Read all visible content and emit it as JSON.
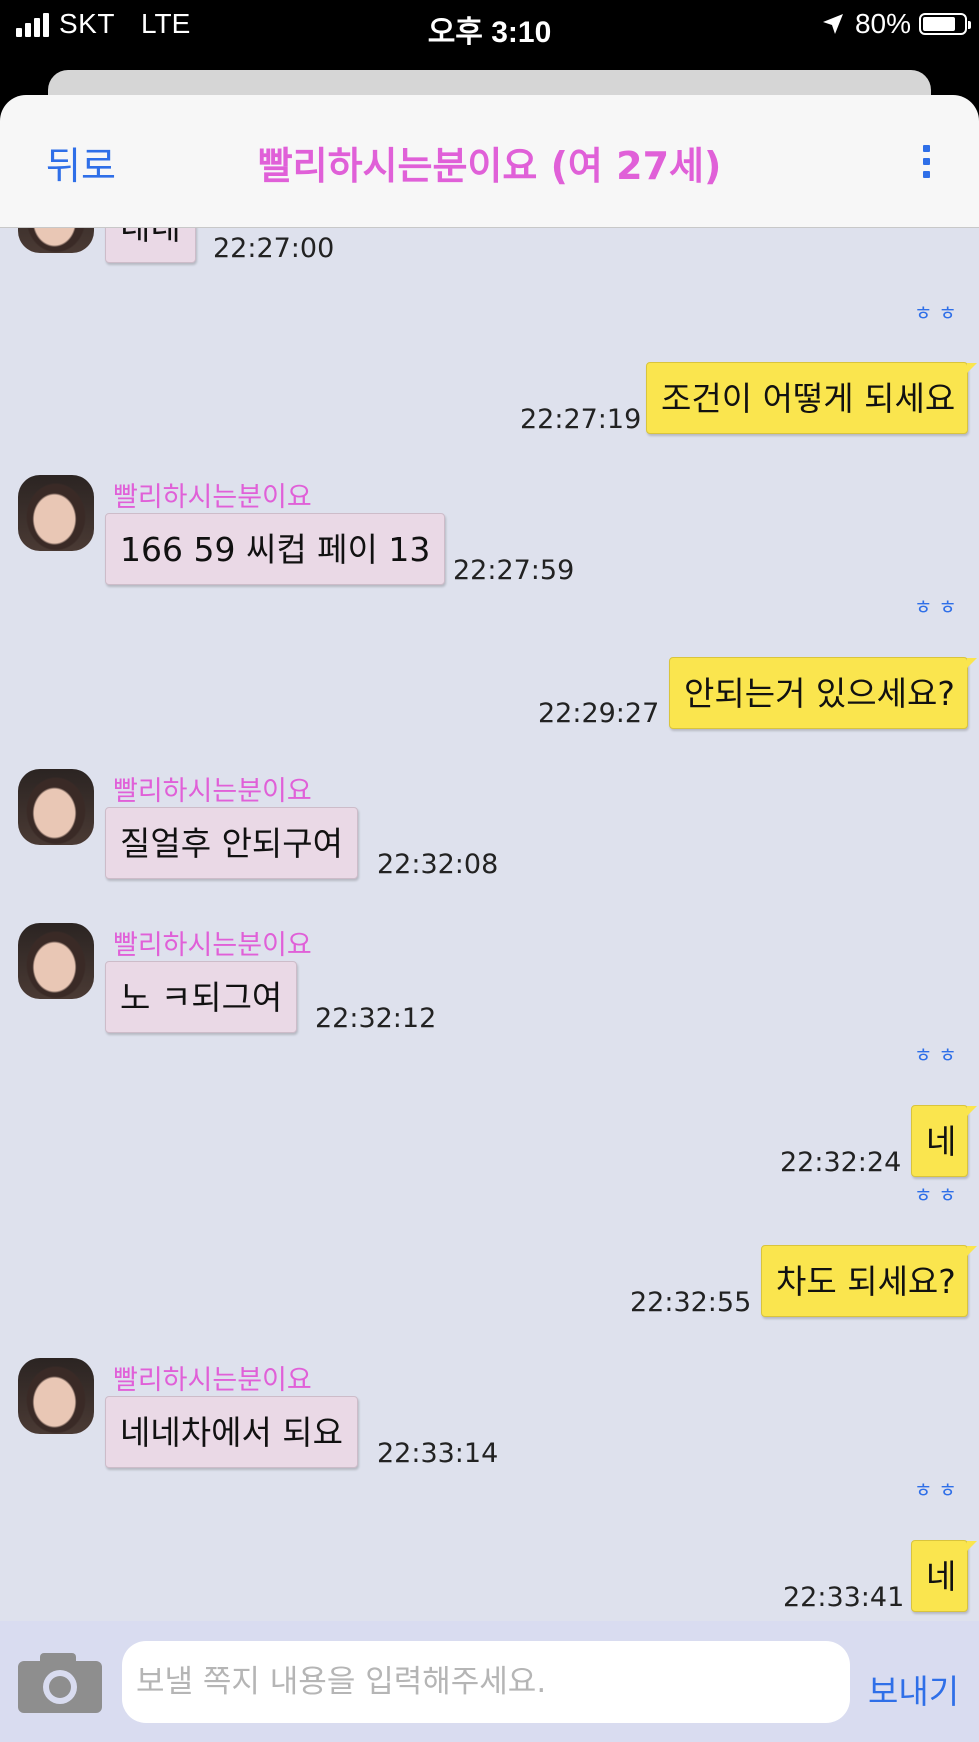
{
  "status_bar": {
    "carrier": "SKT",
    "network": "LTE",
    "time": "오후 3:10",
    "battery_percent": "80%",
    "battery_level": 0.8
  },
  "header": {
    "back_label": "뒤로",
    "title": "빨리하시는분이요 (여 27세)",
    "menu_icon": "kebab-menu-icon"
  },
  "messages": [
    {
      "side": "in",
      "sender": "",
      "text": "네네",
      "time": "22:27:00"
    },
    {
      "side": "out",
      "read": "ㅎㅎ",
      "text": "조건이 어떻게 되세요",
      "time": "22:27:19"
    },
    {
      "side": "in",
      "sender": "빨리하시는분이요",
      "text": "166 59 씨컵 페이 13",
      "time": "22:27:59"
    },
    {
      "side": "out",
      "read": "ㅎㅎ",
      "text": "안되는거 있으세요?",
      "time": "22:29:27"
    },
    {
      "side": "in",
      "sender": "빨리하시는분이요",
      "text": "질얼후 안되구여",
      "time": "22:32:08"
    },
    {
      "side": "in",
      "sender": "빨리하시는분이요",
      "text": "노 ㅋ되그여",
      "time": "22:32:12"
    },
    {
      "side": "out",
      "read": "ㅎㅎ",
      "text": "네",
      "time": "22:32:24"
    },
    {
      "side": "out",
      "read": "ㅎㅎ",
      "text": "차도 되세요?",
      "time": "22:32:55"
    },
    {
      "side": "in",
      "sender": "빨리하시는분이요",
      "text": "네네차에서 되요",
      "time": "22:33:14"
    },
    {
      "side": "out",
      "read": "ㅎㅎ",
      "text": "네",
      "time": "22:33:41"
    }
  ],
  "composer": {
    "placeholder": "보낼 쪽지 내용을 입력해주세요.",
    "send_label": "보내기",
    "camera_icon": "camera-icon"
  },
  "colors": {
    "accent_blue": "#2f6fe8",
    "sender_pink": "#e060d8",
    "incoming_bubble": "#ead9e6",
    "outgoing_bubble": "#fae54e",
    "chat_background": "#dee1ed"
  }
}
